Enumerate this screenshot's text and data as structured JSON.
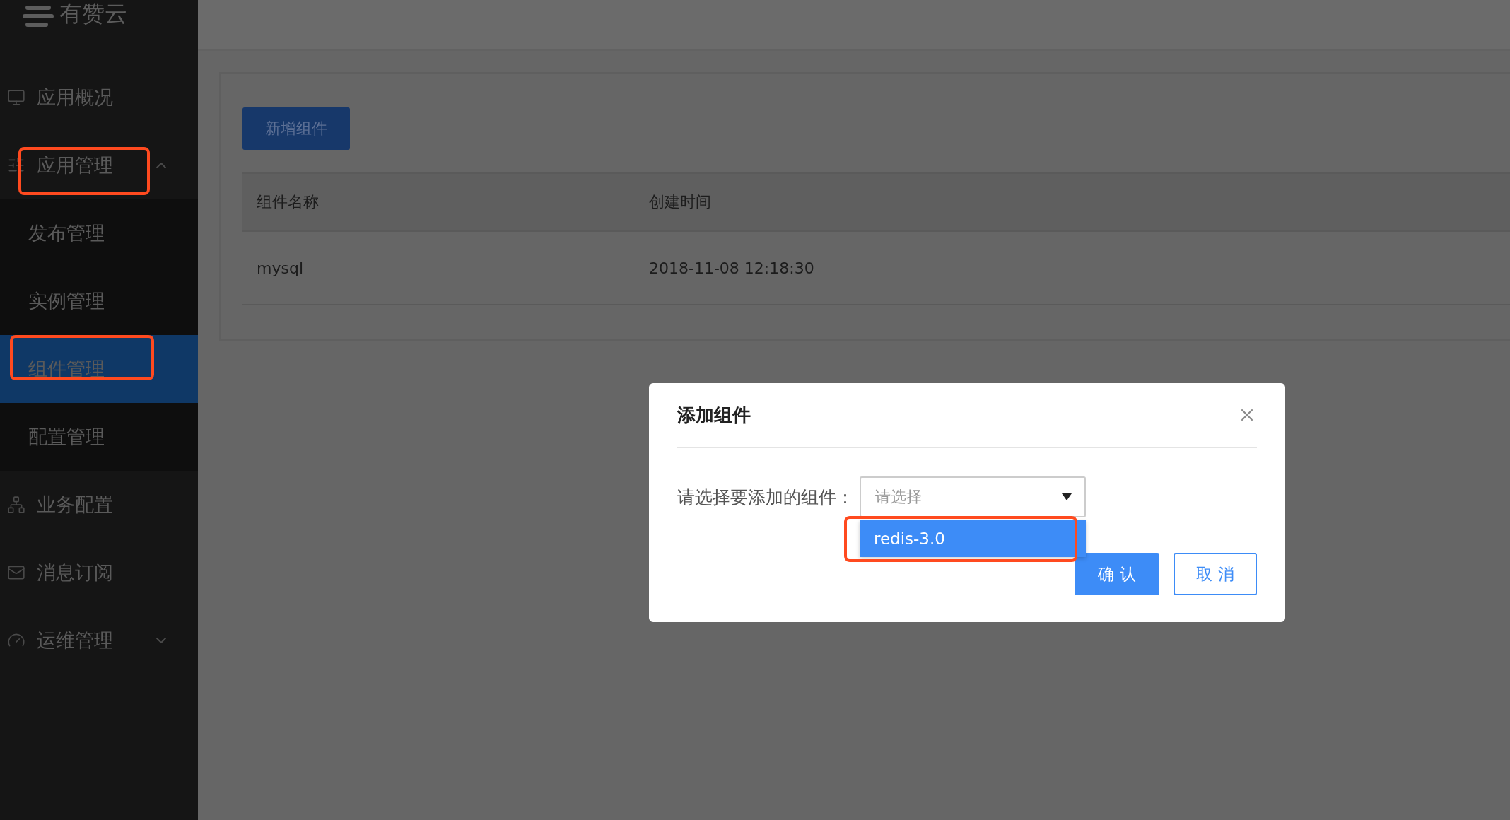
{
  "logo": {
    "text": "有赞云"
  },
  "sidebar": {
    "items": [
      {
        "label": "应用概况",
        "annotated": false
      },
      {
        "label": "应用管理",
        "expanded": true,
        "annotated": true,
        "children": [
          {
            "label": "发布管理",
            "selected": false,
            "annotated": false
          },
          {
            "label": "实例管理",
            "selected": false,
            "annotated": false
          },
          {
            "label": "组件管理",
            "selected": true,
            "annotated": true
          },
          {
            "label": "配置管理",
            "selected": false,
            "annotated": false
          }
        ]
      },
      {
        "label": "业务配置",
        "annotated": false
      },
      {
        "label": "消息订阅",
        "annotated": false
      },
      {
        "label": "运维管理",
        "expanded": false,
        "annotated": false
      }
    ]
  },
  "main": {
    "add_button": "新增组件",
    "table": {
      "columns": [
        "组件名称",
        "创建时间"
      ],
      "rows": [
        [
          "mysql",
          "2018-11-08 12:18:30"
        ]
      ]
    }
  },
  "modal": {
    "title": "添加组件",
    "label": "请选择要添加的组件：",
    "select": {
      "placeholder": "请选择",
      "open": true,
      "options": [
        {
          "label": "redis-3.0",
          "highlighted": true,
          "annotated": true
        }
      ]
    },
    "buttons": [
      {
        "label": "确 认",
        "kind": "primary"
      },
      {
        "label": "取 消",
        "kind": "default"
      }
    ]
  }
}
